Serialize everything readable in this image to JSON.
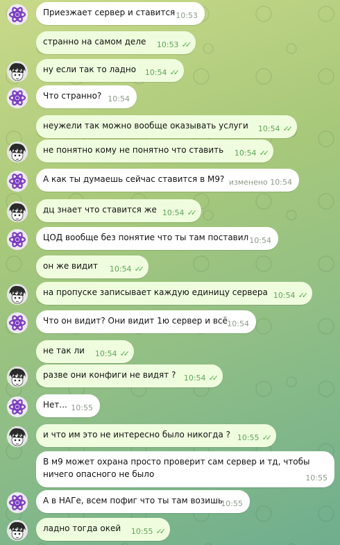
{
  "messages": [
    {
      "text": "Приезжает сервер и ставится",
      "time": "10:53",
      "avatar": "atom",
      "out": false
    },
    {
      "text": "странно на самом деле",
      "time": "10:53",
      "avatar": "",
      "out": true
    },
    {
      "text": "ну если так то ладно",
      "time": "10:54",
      "avatar": "manga",
      "out": true
    },
    {
      "text": "Что странно?",
      "time": "10:54",
      "avatar": "atom",
      "out": false
    },
    {
      "text": "неужели так можно вообще оказывать услуги",
      "time": "10:54",
      "avatar": "",
      "out": true
    },
    {
      "text": "не понятно кому не понятно что ставить",
      "time": "10:54",
      "avatar": "manga",
      "out": true
    },
    {
      "text": "А как ты думаешь сейчас ставится в М9?",
      "time": "изменено 10:54",
      "avatar": "atom",
      "out": false
    },
    {
      "text": "дц знает что ставится же",
      "time": "10:54",
      "avatar": "manga",
      "out": true
    },
    {
      "text": "ЦОД вообще без понятие что ты там поставил",
      "time": "10:54",
      "avatar": "atom",
      "out": false
    },
    {
      "text": "он же видит",
      "time": "10:54",
      "avatar": "",
      "out": true
    },
    {
      "text": "на пропуске записывает каждую единицу сервера",
      "time": "10:54",
      "avatar": "manga",
      "out": true
    },
    {
      "text": "Что он видит? Они видит 1ю сервер и всё",
      "time": "10:54",
      "avatar": "atom",
      "out": false
    },
    {
      "text": "не так ли",
      "time": "10:54",
      "avatar": "",
      "out": true
    },
    {
      "text": "разве они конфиги не видят ?",
      "time": "10:54",
      "avatar": "manga",
      "out": true
    },
    {
      "text": "Нет...",
      "time": "10:55",
      "avatar": "atom",
      "out": false
    },
    {
      "text": "и что им это не интересно было никогда ?",
      "time": "10:55",
      "avatar": "manga",
      "out": true
    },
    {
      "text": "В м9 может охрана просто проверит сам сервер и тд, чтобы ничего опасного не было",
      "time": "10:55",
      "avatar": "",
      "out": false
    },
    {
      "text": "А в НАГе, всем пофиг что ты там возишь",
      "time": "10:55",
      "avatar": "atom",
      "out": false
    },
    {
      "text": "ладно тогда окей",
      "time": "10:55",
      "avatar": "manga",
      "out": true
    }
  ]
}
